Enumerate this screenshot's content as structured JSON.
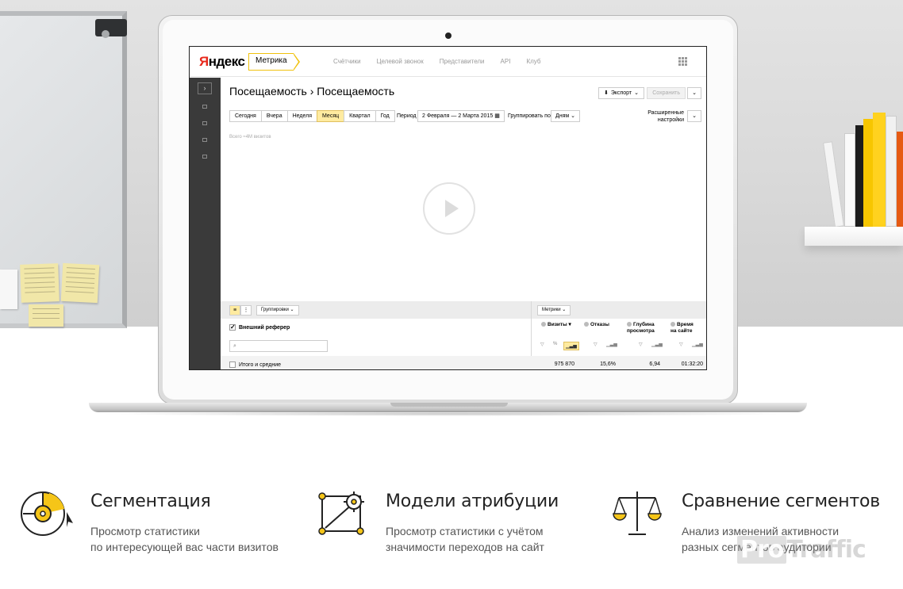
{
  "brand": {
    "logo_text": "Яндекс",
    "product": "Метрика"
  },
  "topnav": [
    "Счётчики",
    "Целевой звонок",
    "Представители",
    "API",
    "Клуб"
  ],
  "breadcrumb": "Посещаемость › Посещаемость",
  "toolbar": {
    "export": "Экспорт",
    "save": "Сохранить"
  },
  "periods": [
    "Сегодня",
    "Вчера",
    "Неделя",
    "Месяц",
    "Квартал",
    "Год"
  ],
  "period_label": "Период",
  "period_value": "2 Февраля — 2 Марта 2015",
  "group_label": "Группировать по",
  "group_value": "Дням",
  "advanced": "Расширенные настройки",
  "total_visits": "Всего ≈4M визитов",
  "table": {
    "groupings_btn": "Группировки",
    "metrics_btn": "Метрики",
    "dimension": "Внешний реферер",
    "columns": [
      "Визиты",
      "Отказы",
      "Глубина просмотра",
      "Время на сайте"
    ],
    "totals_label": "Итого и средние",
    "totals": [
      "975 870",
      "15,6%",
      "6,94",
      "01:32:20"
    ]
  },
  "features": [
    {
      "title": "Сегментация",
      "desc1": "Просмотр статистики",
      "desc2": "по интересующей вас части визитов"
    },
    {
      "title": "Модели атрибуции",
      "desc1": "Просмотр статистики с учётом",
      "desc2": "значимости переходов на сайт"
    },
    {
      "title": "Сравнение сегментов",
      "desc1": "Анализ изменений активности",
      "desc2": "разных сегментов аудитории"
    }
  ],
  "watermark": {
    "pro": "Pro",
    "rest": "Traffic"
  },
  "colors": {
    "accent": "#f5c518",
    "period_active": "#ffeba0",
    "brand_red": "#e8281b"
  }
}
